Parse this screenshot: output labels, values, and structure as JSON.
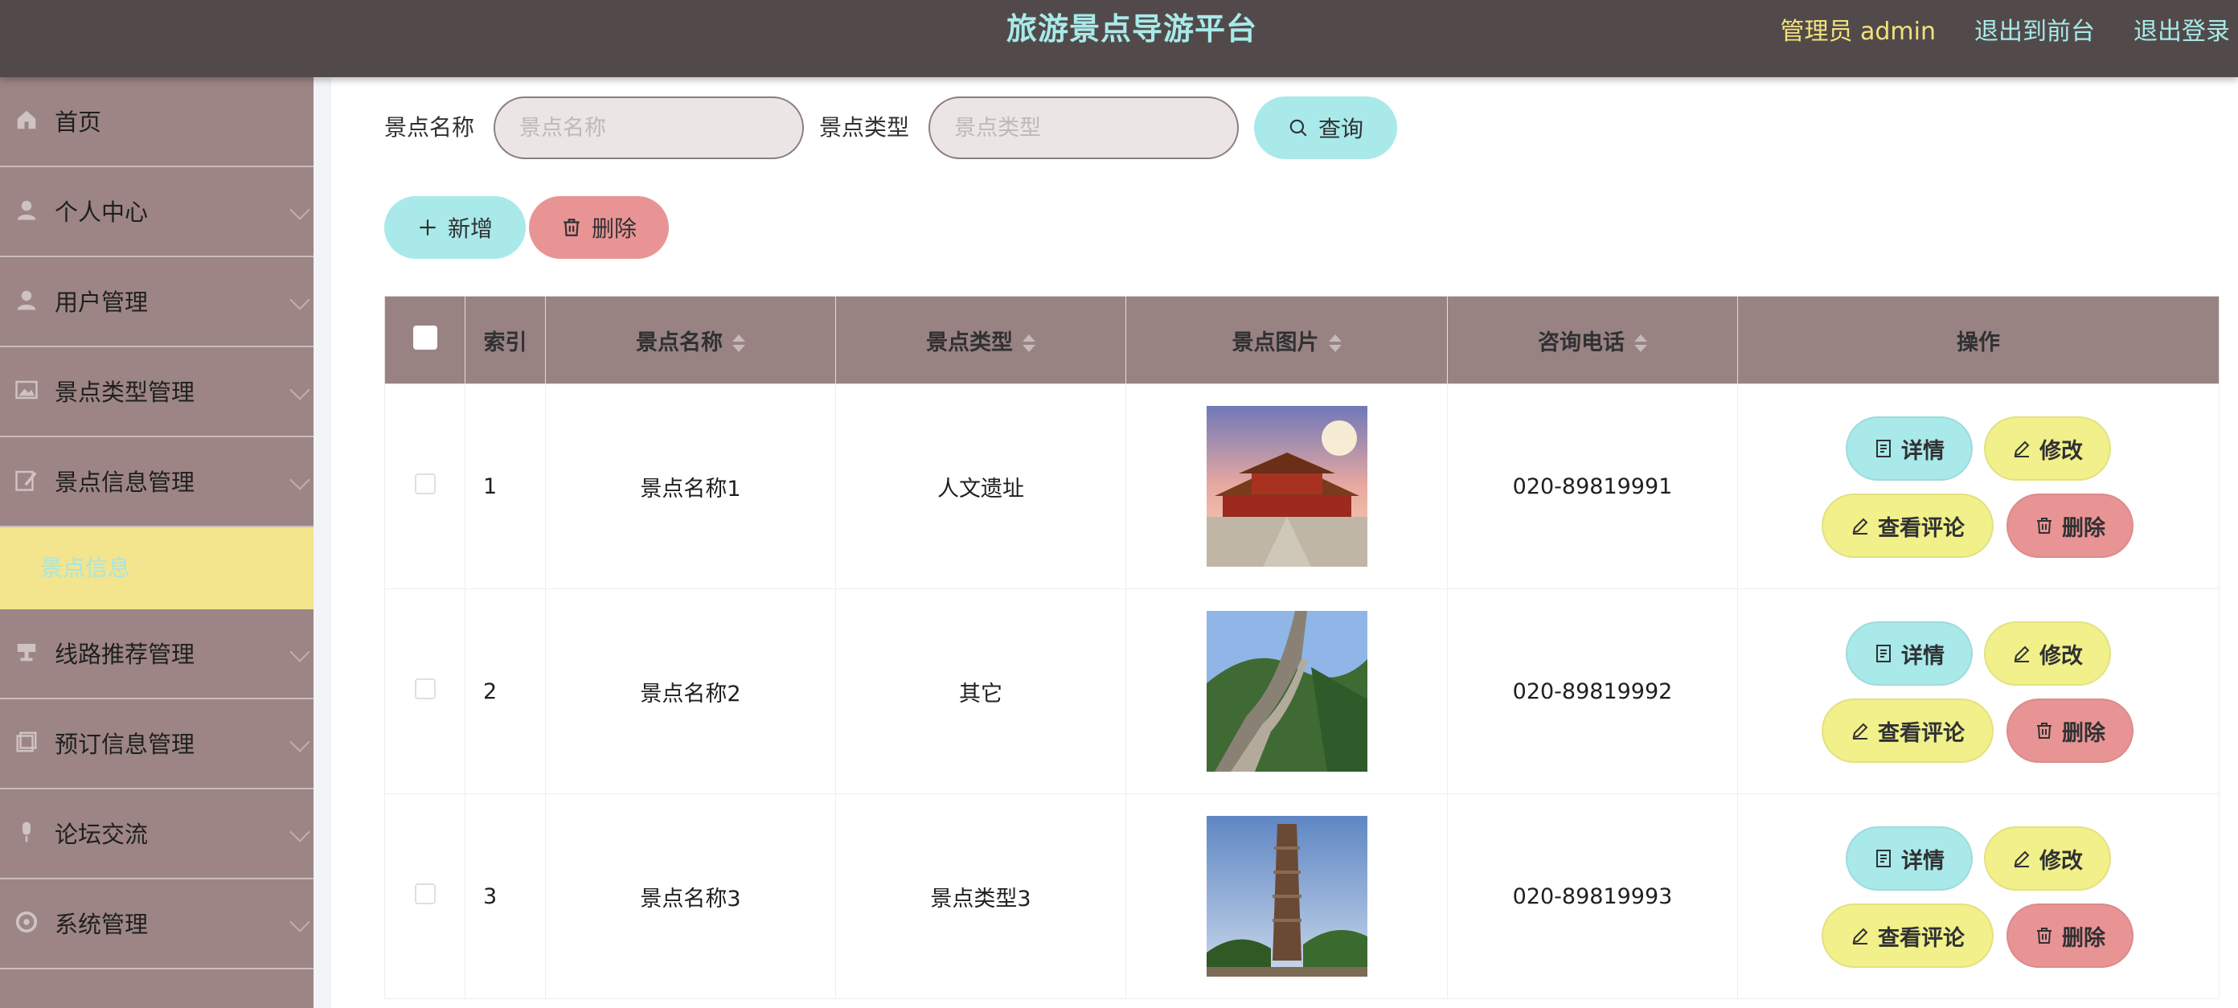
{
  "header": {
    "title": "旅游景点导游平台",
    "admin_label": "管理员 admin",
    "to_front_label": "退出到前台",
    "logout_label": "退出登录"
  },
  "sidebar": {
    "items": [
      {
        "label": "首页",
        "icon": "home-icon"
      },
      {
        "label": "个人中心",
        "icon": "user-icon"
      },
      {
        "label": "用户管理",
        "icon": "user-icon"
      },
      {
        "label": "景点类型管理",
        "icon": "picture-icon"
      },
      {
        "label": "景点信息管理",
        "icon": "edit-icon"
      },
      {
        "label": "线路推荐管理",
        "icon": "cup-icon"
      },
      {
        "label": "预订信息管理",
        "icon": "copy-icon"
      },
      {
        "label": "论坛交流",
        "icon": "mic-icon"
      },
      {
        "label": "系统管理",
        "icon": "gear-icon"
      }
    ],
    "active_sub_label": "景点信息"
  },
  "search": {
    "name_label": "景点名称",
    "name_placeholder": "景点名称",
    "type_label": "景点类型",
    "type_placeholder": "景点类型",
    "query_label": "查询"
  },
  "actions": {
    "add_label": "新增",
    "delete_label": "删除"
  },
  "table": {
    "columns": [
      "索引",
      "景点名称",
      "景点类型",
      "景点图片",
      "咨询电话",
      "操作"
    ],
    "rows": [
      {
        "index": "1",
        "name": "景点名称1",
        "type": "人文遗址",
        "image": "forbidden-city-photo",
        "phone": "020-89819991"
      },
      {
        "index": "2",
        "name": "景点名称2",
        "type": "其它",
        "image": "great-wall-photo",
        "phone": "020-89819992"
      },
      {
        "index": "3",
        "name": "景点名称3",
        "type": "景点类型3",
        "image": "stone-tower-photo",
        "phone": "020-89819993"
      }
    ],
    "row_actions": {
      "detail": "详情",
      "edit": "修改",
      "comments": "查看评论",
      "delete": "删除"
    }
  },
  "colors": {
    "header_bg": "#524a4a",
    "sidebar_bg": "#9d8585",
    "accent_cyan": "#a9e9e9",
    "accent_red": "#e99494",
    "accent_yellow": "#f1f08a"
  }
}
